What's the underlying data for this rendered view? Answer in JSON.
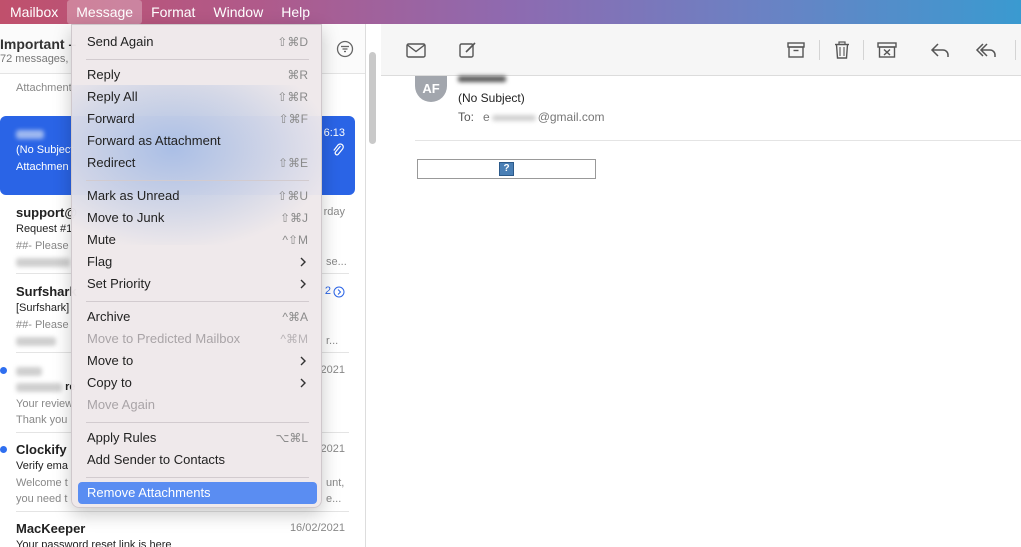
{
  "menubar": {
    "items": [
      "Mailbox",
      "Message",
      "Format",
      "Window",
      "Help"
    ]
  },
  "mailbox": {
    "title": "Important – ",
    "count": "72 messages, "
  },
  "list": {
    "rows": [
      {
        "from": "",
        "date": "",
        "subject": "",
        "preview": "Attachment"
      },
      {
        "from": "",
        "date": "6:13",
        "subject": "(No Subject",
        "preview": "Attachmen"
      },
      {
        "from": "support@",
        "date": "rday",
        "subject": "Request #1",
        "preview": "##- Please",
        "preview2": "se..."
      },
      {
        "from": "Surfshark",
        "date": "2",
        "subject": "[Surfshark]",
        "preview": "##- Please",
        "preview2": "r..."
      },
      {
        "from": "",
        "date": "2021",
        "subject": "re",
        "preview": "Your review",
        "preview2": "Thank you"
      },
      {
        "from": "Clockify",
        "date": "2021",
        "subject": "Verify ema",
        "preview": "Welcome t",
        "preview2": "you need t",
        "tail1": "unt,",
        "tail2": "e..."
      },
      {
        "from": "MacKeeper",
        "date": "16/02/2021",
        "subject": "Your password reset link is here"
      }
    ]
  },
  "reading": {
    "avatar": "AF",
    "subject": "(No Subject)",
    "to_label": "To:",
    "to_prefix": "e",
    "to_domain": "@gmail.com",
    "image_glyph": "?"
  },
  "menu": {
    "items": [
      {
        "label": "Send Again",
        "shortcut": "⇧⌘D"
      },
      {
        "label": "Reply",
        "shortcut": "⌘R"
      },
      {
        "label": "Reply All",
        "shortcut": "⇧⌘R"
      },
      {
        "label": "Forward",
        "shortcut": "⇧⌘F"
      },
      {
        "label": "Forward as Attachment",
        "shortcut": ""
      },
      {
        "label": "Redirect",
        "shortcut": "⇧⌘E"
      },
      {
        "label": "Mark as Unread",
        "shortcut": "⇧⌘U"
      },
      {
        "label": "Move to Junk",
        "shortcut": "⇧⌘J"
      },
      {
        "label": "Mute",
        "shortcut": "^⇧M"
      },
      {
        "label": "Flag",
        "shortcut": ""
      },
      {
        "label": "Set Priority",
        "shortcut": ""
      },
      {
        "label": "Archive",
        "shortcut": "^⌘A"
      },
      {
        "label": "Move to Predicted Mailbox",
        "shortcut": "^⌘M"
      },
      {
        "label": "Move to",
        "shortcut": ""
      },
      {
        "label": "Copy to",
        "shortcut": ""
      },
      {
        "label": "Move Again",
        "shortcut": ""
      },
      {
        "label": "Apply Rules",
        "shortcut": "⌥⌘L"
      },
      {
        "label": "Add Sender to Contacts",
        "shortcut": ""
      },
      {
        "label": "Remove Attachments",
        "shortcut": ""
      }
    ]
  },
  "colors": {
    "selection": "#2a64e6",
    "menu_highlight": "#5a8df2",
    "unread_dot": "#2f6ff0"
  }
}
